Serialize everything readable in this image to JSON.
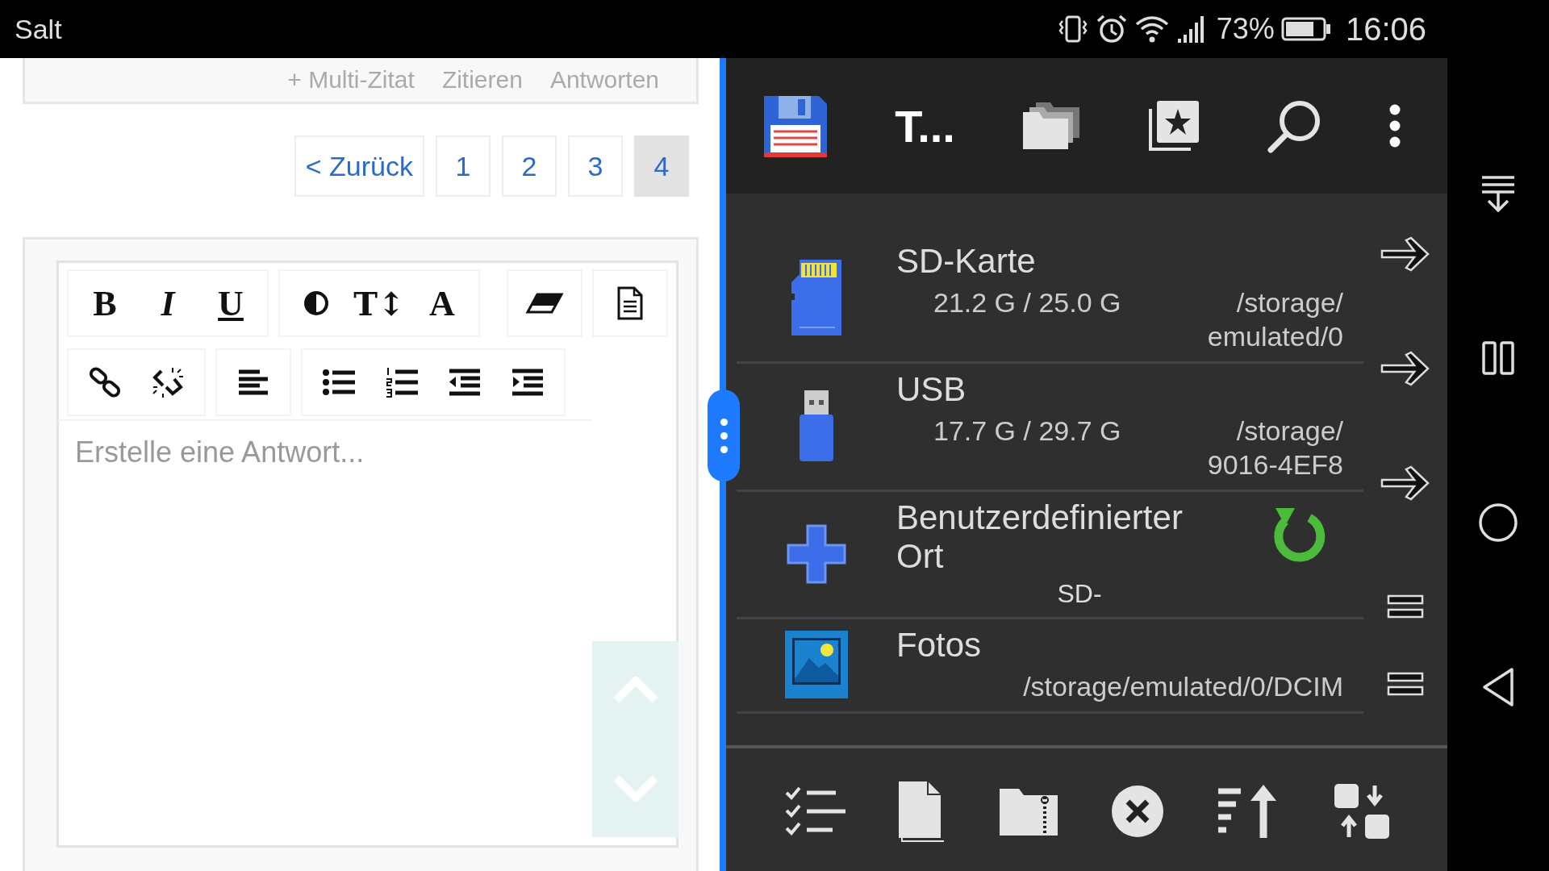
{
  "status_bar": {
    "carrier": "Salt",
    "battery": "73%",
    "time": "16:06"
  },
  "post_actions": [
    "+ Multi-Zitat",
    "Zitieren",
    "Antworten"
  ],
  "pagination": [
    {
      "label": "< Zurück",
      "selected": false
    },
    {
      "label": "1",
      "selected": false
    },
    {
      "label": "2",
      "selected": false
    },
    {
      "label": "3",
      "selected": false
    },
    {
      "label": "4",
      "selected": true
    }
  ],
  "editor": {
    "toolbar": [
      [
        [
          {
            "kind": "bold",
            "label": "B"
          },
          {
            "kind": "italic",
            "label": "I"
          },
          {
            "kind": "underline",
            "label": "U"
          }
        ],
        [
          {
            "kind": "contrast"
          },
          {
            "kind": "font-size",
            "label": "T↕"
          },
          {
            "kind": "font",
            "label": "A"
          }
        ],
        [
          {
            "kind": "eraser"
          }
        ],
        [
          {
            "kind": "source"
          }
        ]
      ],
      [
        [
          {
            "kind": "link"
          },
          {
            "kind": "unlink"
          }
        ],
        [
          {
            "kind": "align-left"
          }
        ],
        [
          {
            "kind": "bullet-list"
          },
          {
            "kind": "numbered-list"
          },
          {
            "kind": "outdent"
          },
          {
            "kind": "indent"
          }
        ]
      ]
    ],
    "placeholder": "Erstelle eine Antwort..."
  },
  "file_manager": {
    "title": "T...",
    "locations": [
      {
        "kind": "sd-card",
        "name": "SD-Karte",
        "size": "21.2 G / 25.0 G",
        "path": [
          "/storage/",
          "emulated/0"
        ]
      },
      {
        "kind": "usb",
        "name": "USB",
        "size": "17.7 G / 29.7 G",
        "path": [
          "/storage/",
          "9016-4EF8"
        ]
      },
      {
        "kind": "custom",
        "name": "Benutzerdefinierter Ort",
        "note": "SD-"
      },
      {
        "kind": "photos",
        "name": "Fotos",
        "path": [
          "/storage/emulated/0/DCIM"
        ]
      }
    ],
    "side_actions": [
      {
        "kind": "open"
      },
      {
        "kind": "open"
      },
      {
        "kind": "open"
      },
      {
        "kind": "drag"
      },
      {
        "kind": "drag"
      }
    ]
  }
}
